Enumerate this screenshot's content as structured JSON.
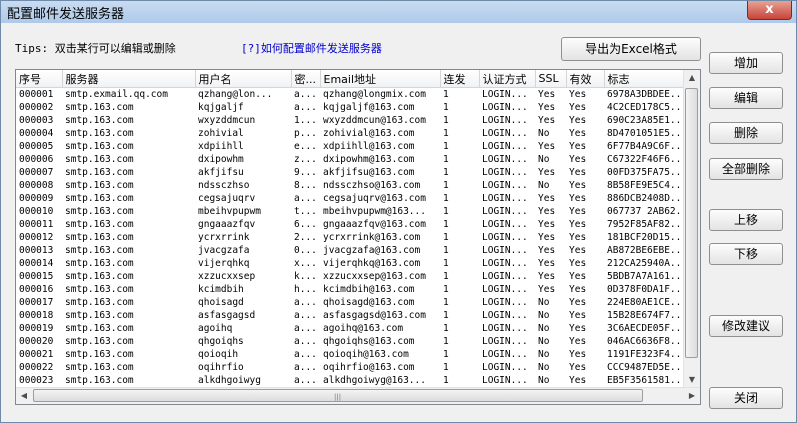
{
  "window": {
    "title": "配置邮件发送服务器",
    "close_label": "x"
  },
  "tips": "Tips: 双击某行可以编辑或删除",
  "help_link": "[?]如何配置邮件发送服务器",
  "buttons": {
    "export": "导出为Excel格式",
    "add": "增加",
    "edit": "编辑",
    "delete": "删除",
    "delete_all": "全部删除",
    "move_up": "上移",
    "move_down": "下移",
    "suggest": "修改建议",
    "close": "关闭"
  },
  "columns": [
    "序号",
    "服务器",
    "用户名",
    "密...",
    "Email地址",
    "连发",
    "认证方式",
    "SSL",
    "有效",
    "标志"
  ],
  "rows": [
    [
      "000001",
      "smtp.exmail.qq.com",
      "qzhang@lon...",
      "a...",
      "qzhang@longmix.com",
      "1",
      "LOGIN...",
      "Yes",
      "Yes",
      "6978A3DBDEE..."
    ],
    [
      "000002",
      "smtp.163.com",
      "kqjgaljf",
      "a...",
      "kqjgaljf@163.com",
      "1",
      "LOGIN...",
      "Yes",
      "Yes",
      "4C2CED178C5..."
    ],
    [
      "000003",
      "smtp.163.com",
      "wxyzddmcun",
      "1...",
      "wxyzddmcun@163.com",
      "1",
      "LOGIN...",
      "Yes",
      "Yes",
      "690C23A85E1..."
    ],
    [
      "000004",
      "smtp.163.com",
      "zohivial",
      "p...",
      "zohivial@163.com",
      "1",
      "LOGIN...",
      "No",
      "Yes",
      "8D4701051E5..."
    ],
    [
      "000005",
      "smtp.163.com",
      "xdpiihll",
      "e...",
      "xdpiihll@163.com",
      "1",
      "LOGIN...",
      "Yes",
      "Yes",
      "6F77B4A9C6F..."
    ],
    [
      "000006",
      "smtp.163.com",
      "dxipowhm",
      "z...",
      "dxipowhm@163.com",
      "1",
      "LOGIN...",
      "No",
      "Yes",
      "C67322F46F6..."
    ],
    [
      "000007",
      "smtp.163.com",
      "akfjifsu",
      "9...",
      "akfjifsu@163.com",
      "1",
      "LOGIN...",
      "Yes",
      "Yes",
      "00FD375FA75..."
    ],
    [
      "000008",
      "smtp.163.com",
      "ndssczhso",
      "8...",
      "ndssczhso@163.com",
      "1",
      "LOGIN...",
      "No",
      "Yes",
      "8B58FE9E5C4..."
    ],
    [
      "000009",
      "smtp.163.com",
      "cegsajuqrv",
      "a...",
      "cegsajuqrv@163.com",
      "1",
      "LOGIN...",
      "Yes",
      "Yes",
      "886DCB2408D..."
    ],
    [
      "000010",
      "smtp.163.com",
      "mbeihvpupwm",
      "t...",
      "mbeihvpupwm@163...",
      "1",
      "LOGIN...",
      "Yes",
      "Yes",
      "067737 2AB62..."
    ],
    [
      "000011",
      "smtp.163.com",
      "gngaaazfqv",
      "6...",
      "gngaaazfqv@163.com",
      "1",
      "LOGIN...",
      "Yes",
      "Yes",
      "7952F85AF82..."
    ],
    [
      "000012",
      "smtp.163.com",
      "ycrxrrink",
      "2...",
      "ycrxrrink@163.com",
      "1",
      "LOGIN...",
      "Yes",
      "Yes",
      "181BCF20D15..."
    ],
    [
      "000013",
      "smtp.163.com",
      "jvacgzafa",
      "0...",
      "jvacgzafa@163.com",
      "1",
      "LOGIN...",
      "Yes",
      "Yes",
      "AB872BE6EBE..."
    ],
    [
      "000014",
      "smtp.163.com",
      "vijerqhkq",
      "x...",
      "vijerqhkq@163.com",
      "1",
      "LOGIN...",
      "Yes",
      "Yes",
      "212CA25940A..."
    ],
    [
      "000015",
      "smtp.163.com",
      "xzzucxxsep",
      "k...",
      "xzzucxxsep@163.com",
      "1",
      "LOGIN...",
      "Yes",
      "Yes",
      "5BDB7A7A161..."
    ],
    [
      "000016",
      "smtp.163.com",
      "kcimdbih",
      "h...",
      "kcimdbih@163.com",
      "1",
      "LOGIN...",
      "Yes",
      "Yes",
      "0D378F0DA1F..."
    ],
    [
      "000017",
      "smtp.163.com",
      "qhoisagd",
      "a...",
      "qhoisagd@163.com",
      "1",
      "LOGIN...",
      "No",
      "Yes",
      "224E80AE1CE..."
    ],
    [
      "000018",
      "smtp.163.com",
      "asfasgagsd",
      "a...",
      "asfasgagsd@163.com",
      "1",
      "LOGIN...",
      "No",
      "Yes",
      "15B28E674F7..."
    ],
    [
      "000019",
      "smtp.163.com",
      "agoihq",
      "a...",
      "agoihq@163.com",
      "1",
      "LOGIN...",
      "No",
      "Yes",
      "3C6AECDE05F..."
    ],
    [
      "000020",
      "smtp.163.com",
      "qhgoiqhs",
      "a...",
      "qhgoiqhs@163.com",
      "1",
      "LOGIN...",
      "No",
      "Yes",
      "046AC6636F8..."
    ],
    [
      "000021",
      "smtp.163.com",
      "qoioqih",
      "a...",
      "qoioqih@163.com",
      "1",
      "LOGIN...",
      "No",
      "Yes",
      "1191FE323F4..."
    ],
    [
      "000022",
      "smtp.163.com",
      "oqihrfio",
      "a...",
      "oqihrfio@163.com",
      "1",
      "LOGIN...",
      "No",
      "Yes",
      "CCC9487ED5E..."
    ],
    [
      "000023",
      "smtp.163.com",
      "alkdhgoiwyg",
      "a...",
      "alkdhgoiwyg@163...",
      "1",
      "LOGIN...",
      "No",
      "Yes",
      "EB5F3561581..."
    ]
  ],
  "colors": {
    "link": "#0000cc",
    "title_bar": "#aec9ea",
    "close_button": "#c7443a"
  },
  "icons": {
    "scroll_up": "triangle-up-icon",
    "scroll_down": "triangle-down-icon",
    "scroll_left": "triangle-left-icon",
    "scroll_right": "triangle-right-icon"
  }
}
